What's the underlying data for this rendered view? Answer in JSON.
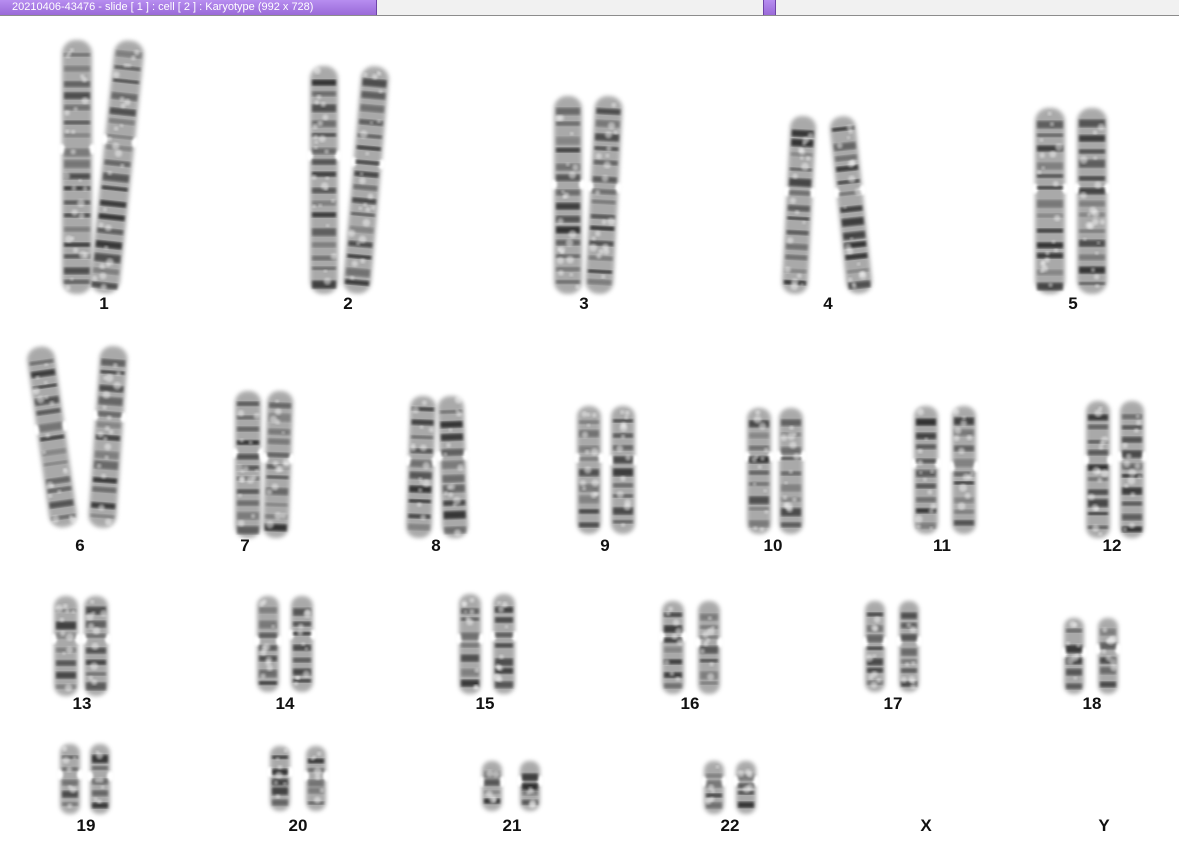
{
  "window": {
    "title": "20210406-43476 - slide [ 1 ] : cell [ 2 ] : Karyotype  (992 x 728)"
  },
  "karyotype": {
    "colors": {
      "band_dark": "#1e1e1e",
      "chromatid": "#9b9b9b",
      "background": "#ffffff"
    },
    "chromosomes": [
      {
        "label": "1",
        "pair": 2
      },
      {
        "label": "2",
        "pair": 2
      },
      {
        "label": "3",
        "pair": 2
      },
      {
        "label": "4",
        "pair": 2
      },
      {
        "label": "5",
        "pair": 2
      },
      {
        "label": "6",
        "pair": 2
      },
      {
        "label": "7",
        "pair": 2
      },
      {
        "label": "8",
        "pair": 2
      },
      {
        "label": "9",
        "pair": 2
      },
      {
        "label": "10",
        "pair": 2
      },
      {
        "label": "11",
        "pair": 2
      },
      {
        "label": "12",
        "pair": 2
      },
      {
        "label": "13",
        "pair": 2
      },
      {
        "label": "14",
        "pair": 2
      },
      {
        "label": "15",
        "pair": 2
      },
      {
        "label": "16",
        "pair": 2
      },
      {
        "label": "17",
        "pair": 2
      },
      {
        "label": "18",
        "pair": 2
      },
      {
        "label": "19",
        "pair": 2
      },
      {
        "label": "20",
        "pair": 2
      },
      {
        "label": "21",
        "pair": 2
      },
      {
        "label": "22",
        "pair": 2
      },
      {
        "label": "X",
        "pair": 0
      },
      {
        "label": "Y",
        "pair": 0
      }
    ]
  }
}
